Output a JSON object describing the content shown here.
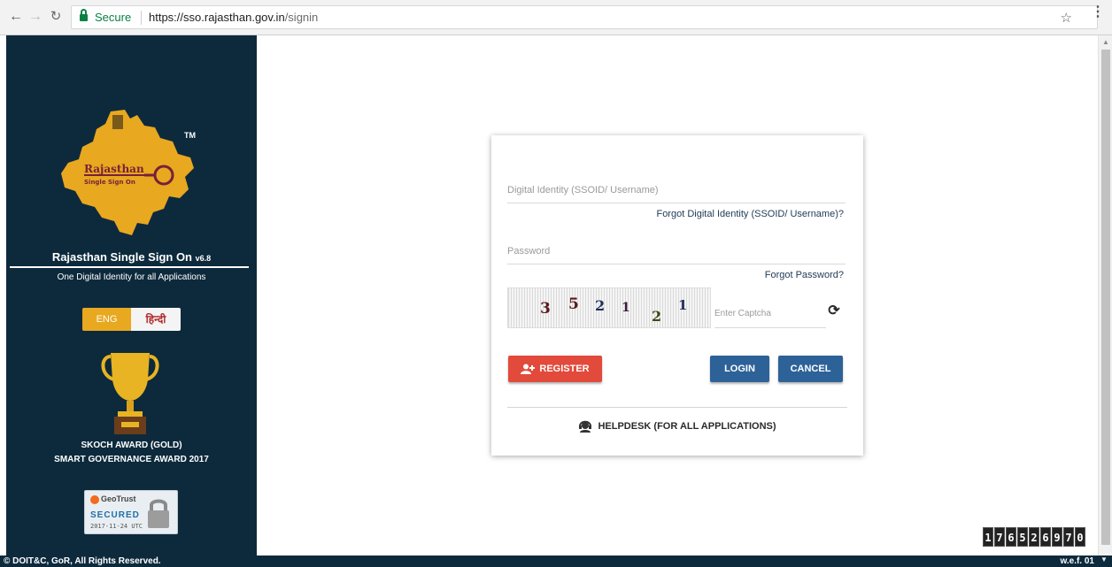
{
  "browser": {
    "secure_label": "Secure",
    "url_host": "https://sso.rajasthan.gov.in",
    "url_path": "/signin"
  },
  "sidebar": {
    "logo_line1": "Rajasthan",
    "logo_line2": "Single Sign On",
    "tm": "TM",
    "title": "Rajasthan Single Sign On",
    "version": "v6.8",
    "subtitle": "One Digital Identity for all Applications",
    "lang_eng": "ENG",
    "lang_hindi": "हिन्दी",
    "award_line1": "SKOCH AWARD (GOLD)",
    "award_line2": "SMART GOVERNANCE AWARD 2017",
    "geotrust_brand": "GeoTrust",
    "geotrust_secured": "SECURED",
    "geotrust_date": "2017-11-24 UTC"
  },
  "login": {
    "ssoid_placeholder": "Digital Identity (SSOID/ Username)",
    "forgot_ssoid": "Forgot Digital Identity (SSOID/ Username)?",
    "password_placeholder": "Password",
    "forgot_password": "Forgot Password?",
    "captcha_digits": [
      "3",
      "5",
      "2",
      "1",
      "2",
      "1"
    ],
    "captcha_placeholder": "Enter Captcha",
    "register_label": "REGISTER",
    "login_label": "LOGIN",
    "cancel_label": "CANCEL",
    "helpdesk_label": "HELPDESK (FOR ALL APPLICATIONS)"
  },
  "footer": {
    "copyright": "© DOIT&C, GoR, All Rights Reserved.",
    "version": "w.e.f. 01"
  },
  "counter": {
    "digits": [
      "1",
      "7",
      "6",
      "5",
      "2",
      "6",
      "9",
      "7",
      "0"
    ]
  },
  "colors": {
    "sidebar_bg": "#0d2a3d",
    "register": "#e24a3b",
    "primary": "#2d6298",
    "lang_active": "#e8a81f"
  }
}
